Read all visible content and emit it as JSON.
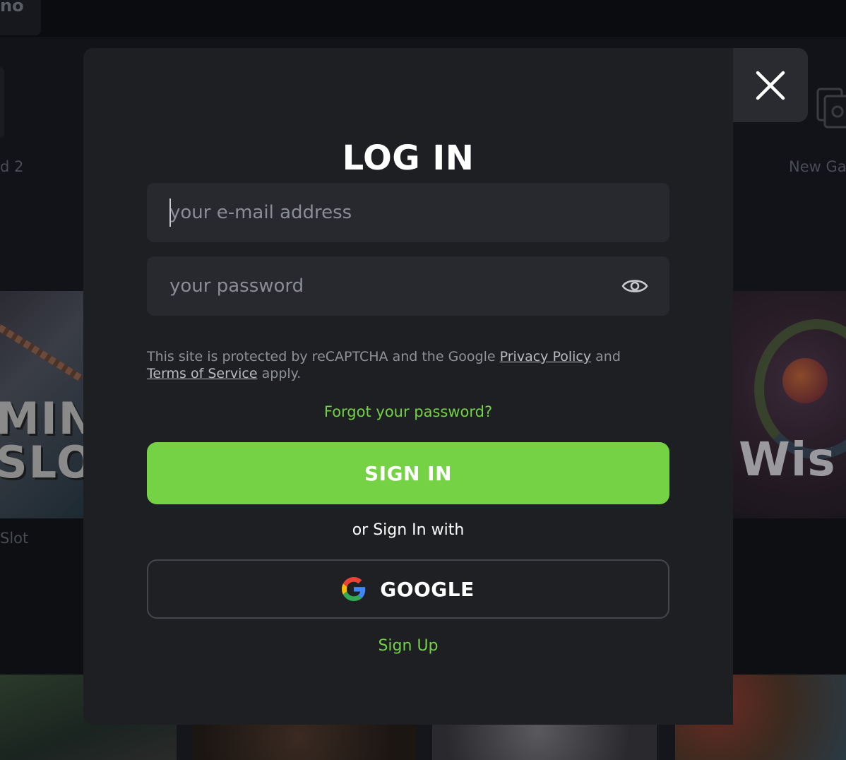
{
  "background": {
    "logo_fragment": "no",
    "label_left_top": "d 2",
    "label_right_top": "New Ga",
    "label_left_mid": "Slot",
    "tile_left_text": "MIN\nSLO",
    "tile_right_text": "Wis"
  },
  "modal": {
    "title": "LOG IN",
    "email": {
      "placeholder": "your e-mail address",
      "value": ""
    },
    "password": {
      "placeholder": "your password",
      "value": ""
    },
    "recaptcha": {
      "prefix": "This site is protected by reCAPTCHA and the Google ",
      "privacy_link": "Privacy Policy",
      "middle": " and ",
      "terms_link": "Terms of Service",
      "suffix": " apply."
    },
    "forgot_password": "Forgot your password?",
    "sign_in_button": "SIGN IN",
    "or_text": "or Sign In with",
    "google_button": "GOOGLE",
    "sign_up_link": "Sign Up"
  },
  "icons": {
    "close": "close-icon",
    "eye": "eye-icon",
    "google": "google-logo-icon"
  },
  "colors": {
    "accent_green": "#74d244",
    "link_green": "#72d146",
    "modal_bg": "#1e1f23",
    "field_bg": "#28292e"
  }
}
